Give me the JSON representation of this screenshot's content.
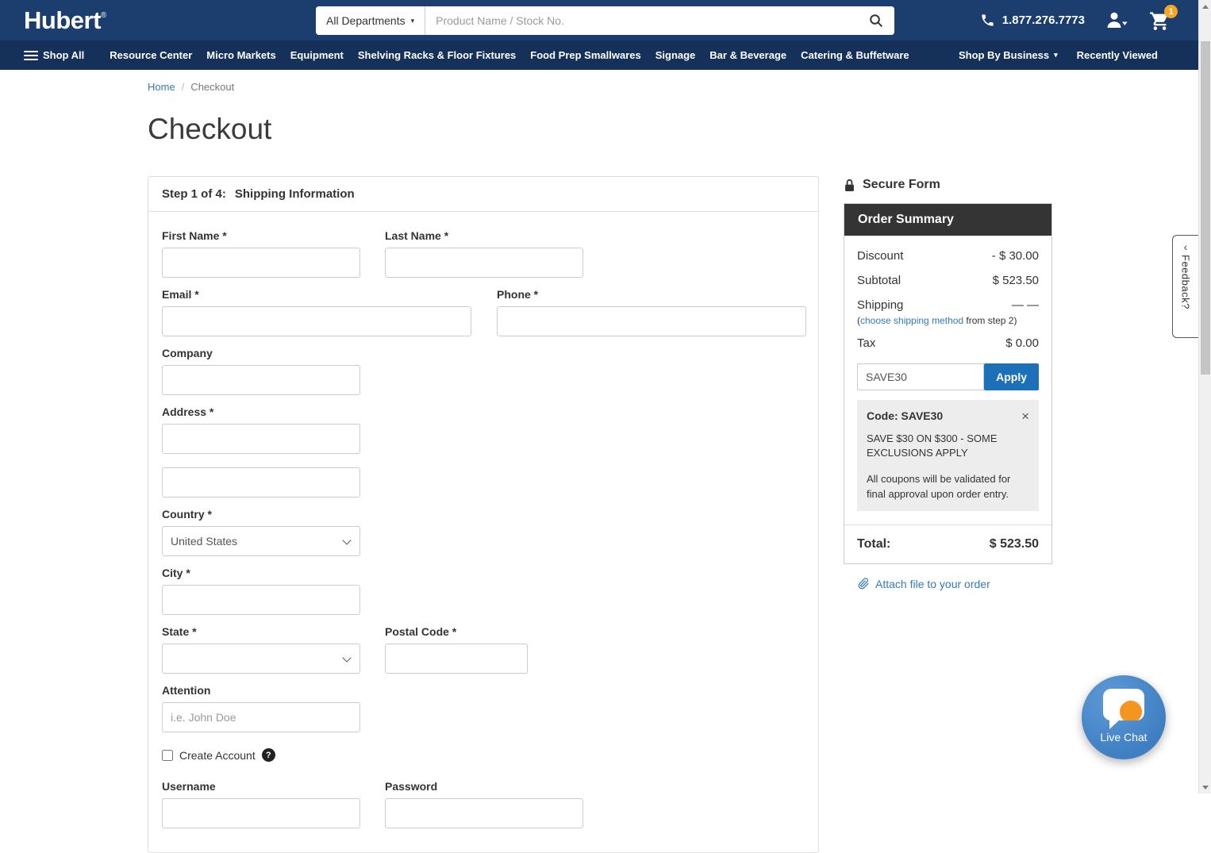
{
  "colors": {
    "header_blue": "#1c3e6e",
    "nav_blue": "#15315a",
    "link_blue": "#337ab7",
    "apply_button_blue": "#1d70b7",
    "cart_badge_orange": "#f5a623",
    "summary_header_dark": "#343434",
    "chat_bubble_orange": "#f5941e",
    "chat_circle_blue": "#4a86c8"
  },
  "header": {
    "logo_text": "Hubert",
    "logo_reg": "®",
    "all_departments": "All Departments",
    "departments_caret": "▾",
    "search_placeholder": "Product Name / Stock No.",
    "phone_number": "1.877.276.7773",
    "cart_badge": "1"
  },
  "nav": {
    "shop_all": "Shop All",
    "items": [
      "Resource Center",
      "Micro Markets",
      "Equipment",
      "Shelving Racks & Floor Fixtures",
      "Food Prep Smallwares",
      "Signage",
      "Bar & Beverage",
      "Catering & Buffetware"
    ],
    "shop_by_business": "Shop By Business",
    "shop_by_business_caret": "▾",
    "recently_viewed": "Recently Viewed"
  },
  "breadcrumb": {
    "home": "Home",
    "separator": "/",
    "current": "Checkout"
  },
  "page": {
    "title": "Checkout"
  },
  "form": {
    "step_label": "Step 1 of 4:",
    "step_title": "Shipping Information",
    "labels": {
      "first_name": "First Name *",
      "last_name": "Last Name *",
      "email": "Email *",
      "phone": "Phone *",
      "company": "Company",
      "address": "Address *",
      "country": "Country *",
      "city": "City *",
      "state": "State *",
      "postal_code": "Postal Code *",
      "attention": "Attention",
      "username": "Username",
      "password": "Password"
    },
    "values": {
      "country": "United States"
    },
    "placeholders": {
      "attention": "i.e. John Doe"
    },
    "create_account_label": "Create Account",
    "help_icon": "?"
  },
  "summary": {
    "secure_form": "Secure Form",
    "title": "Order Summary",
    "discount_label": "Discount",
    "discount_value": "- $ 30.00",
    "subtotal_label": "Subtotal",
    "subtotal_value": "$ 523.50",
    "shipping_label": "Shipping",
    "shipping_value": "— —",
    "shipping_note_prefix": "(",
    "shipping_note_link": "choose shipping method",
    "shipping_note_suffix": " from step 2)",
    "tax_label": "Tax",
    "tax_value": "$ 0.00",
    "coupon_value": "SAVE30",
    "apply_label": "Apply",
    "coupon_code_label": "Code: SAVE30",
    "coupon_close": "×",
    "coupon_description": "SAVE $30 ON $300 - SOME EXCLUSIONS APPLY",
    "coupon_note": "All coupons will be validated for final approval upon order entry.",
    "total_label": "Total:",
    "total_value": "$ 523.50",
    "attach_link": "Attach file to your order"
  },
  "feedback_tab": {
    "chevron": "‹",
    "label": "Feedback?"
  },
  "live_chat": {
    "label": "Live Chat"
  }
}
